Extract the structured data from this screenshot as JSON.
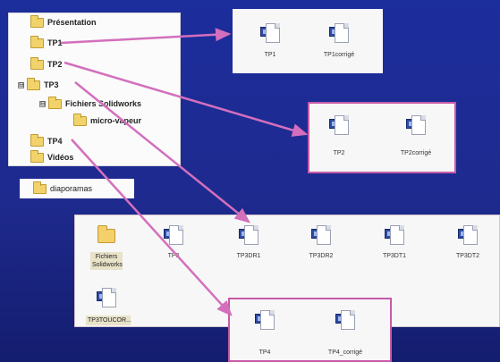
{
  "tree": {
    "items": [
      {
        "label": "Présentation",
        "expander": ""
      },
      {
        "label": "TP1",
        "expander": ""
      },
      {
        "label": "TP2",
        "expander": ""
      },
      {
        "label": "TP3",
        "expander": "⊟"
      },
      {
        "label": "Fichiers Solidworks",
        "expander": "⊟"
      },
      {
        "label": "micro-vapeur",
        "expander": ""
      },
      {
        "label": "TP4",
        "expander": ""
      },
      {
        "label": "Vidéos",
        "expander": ""
      }
    ]
  },
  "diaporamas": {
    "label": "diaporamas"
  },
  "tp1_files": [
    "TP1",
    "TP1corrigé"
  ],
  "tp2_files": [
    "TP2",
    "TP2corrigé"
  ],
  "tp3_files": {
    "folder_label": "Fichiers Solidworks",
    "docs": [
      "TP3",
      "TP3DR1",
      "TP3DR2",
      "TP3DT1",
      "TP3DT2",
      "TP3TOUCOR..."
    ]
  },
  "tp4_files": [
    "TP4",
    "TP4_corrigé"
  ],
  "colors": {
    "arrow": "#d36fbd",
    "background": "#1c2d9c",
    "panel": "#f7f7f7"
  }
}
